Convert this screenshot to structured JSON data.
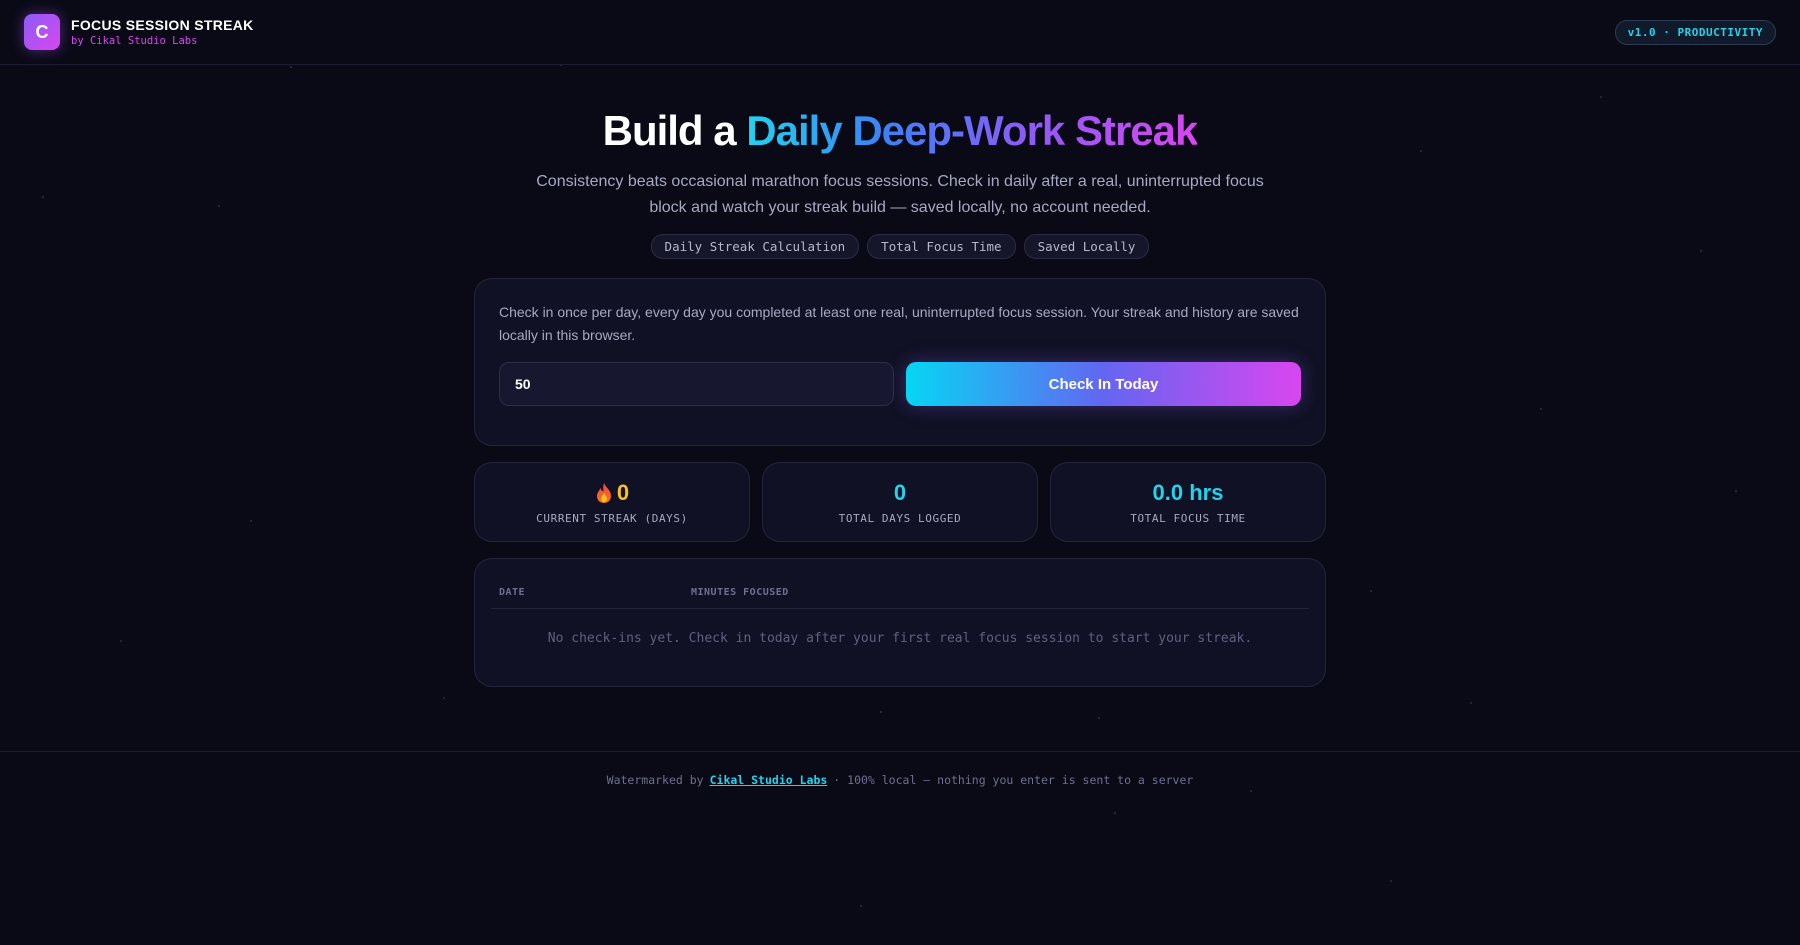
{
  "header": {
    "logo_letter": "C",
    "title": "FOCUS SESSION STREAK",
    "subtitle": "by Cikal Studio Labs",
    "version_badge": "v1.0 · PRODUCTIVITY"
  },
  "hero": {
    "title_plain": "Build a ",
    "title_gradient": "Daily Deep-Work Streak",
    "description": "Consistency beats occasional marathon focus sessions. Check in daily after a real, uninterrupted focus block and watch your streak build — saved locally, no account needed.",
    "tags": [
      "Daily Streak Calculation",
      "Total Focus Time",
      "Saved Locally"
    ]
  },
  "checkin": {
    "description": "Check in once per day, every day you completed at least one real, uninterrupted focus session. Your streak and history are saved locally in this browser.",
    "minutes_value": "50",
    "button_label": "Check In Today"
  },
  "stats": {
    "current_streak": {
      "value": "0",
      "label": "CURRENT STREAK (DAYS)",
      "icon": "flame-icon"
    },
    "total_days": {
      "value": "0",
      "label": "TOTAL DAYS LOGGED"
    },
    "total_focus": {
      "value": "0.0 hrs",
      "label": "TOTAL FOCUS TIME"
    }
  },
  "history": {
    "columns": [
      "DATE",
      "MINUTES FOCUSED"
    ],
    "empty_message": "No check-ins yet. Check in today after your first real focus session to start your streak."
  },
  "footer": {
    "prefix": "Watermarked by",
    "link_text": "Cikal Studio Labs",
    "suffix": "· 100% local — nothing you enter is sent to a server"
  },
  "colors": {
    "background": "#0a0a16",
    "accent_cyan": "#22d3ee",
    "accent_magenta": "#d946ef",
    "accent_violet": "#8b5cf6",
    "streak_amber": "#fbbf24"
  }
}
